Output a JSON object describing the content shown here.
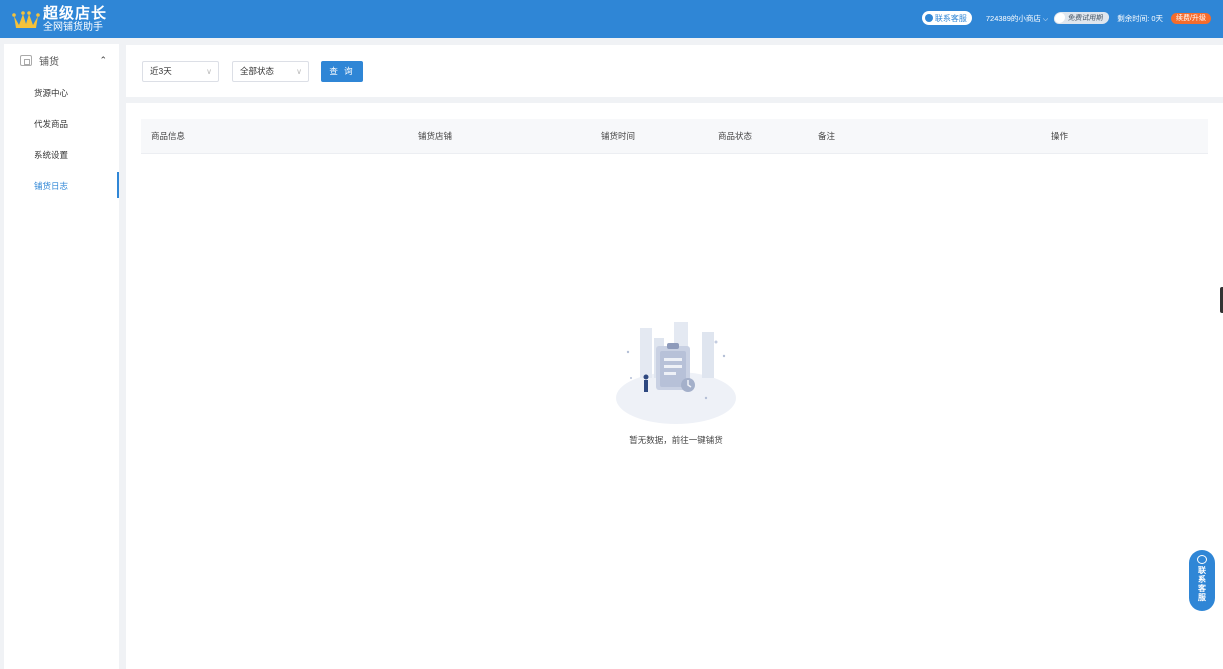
{
  "header": {
    "app_name": "超级店长",
    "app_sub": "全网铺货助手",
    "contact_label": "联系客服",
    "shop_name": "724389的小商店",
    "trial_label": "免费试用期",
    "remaining": "剩余时间: 0天",
    "upgrade_label": "续费/升级",
    "brand_color": "#2f86d6"
  },
  "sidebar": {
    "group_label": "铺货",
    "items": [
      {
        "label": "货源中心"
      },
      {
        "label": "代发商品"
      },
      {
        "label": "系统设置"
      },
      {
        "label": "铺货日志",
        "active": true
      }
    ]
  },
  "filter": {
    "range_value": "近3天",
    "status_value": "全部状态",
    "query_label": "查 询"
  },
  "table": {
    "columns": [
      "商品信息",
      "铺货店铺",
      "铺货时间",
      "商品状态",
      "备注",
      "操作"
    ]
  },
  "empty": {
    "text": "暂无数据，前往一键铺货"
  },
  "float_service": {
    "chars": [
      "联",
      "系",
      "客",
      "服"
    ]
  }
}
